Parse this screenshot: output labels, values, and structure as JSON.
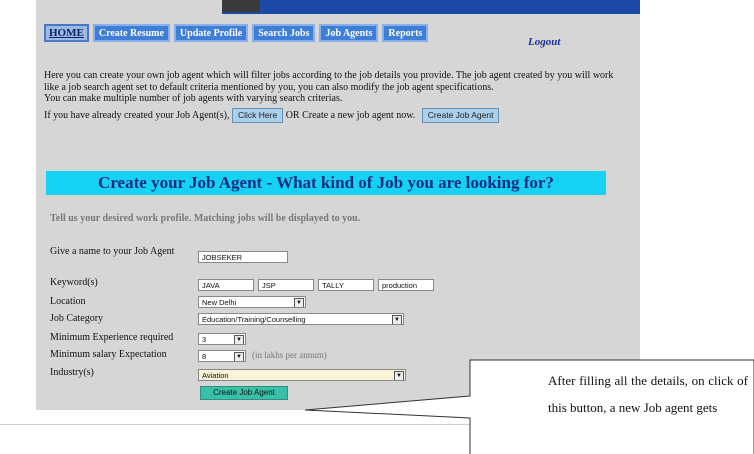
{
  "nav": {
    "home": "HOME",
    "items": [
      "Create Resume",
      "Update Profile",
      "Search Jobs",
      "Job Agents",
      "Reports"
    ],
    "logout": "Logout"
  },
  "intro": {
    "p1": "Here you can create your own job agent which will filter jobs according to the job details you provide. The job agent created by you will work like a job search agent set to default criteria mentioned by you, you can also modify the job agent specifications.",
    "p2": "You can make multiple number of job agents with varying search criterias.",
    "p3_before": "If you have already created your Job Agent(s),",
    "click_here": "Click Here",
    "p3_middle": "OR Create a new job agent now.",
    "create_job_agent_top": "Create Job Agent"
  },
  "banner": "Create your Job Agent - What kind of Job you are looking for?",
  "tell": "Tell us your desired work profile. Matching jobs will be displayed to you.",
  "form": {
    "name_label": "Give a name to your Job Agent",
    "name_value": "JOBSEKER",
    "keywords_label": "Keyword(s)",
    "keywords": [
      "JAVA",
      "JSP",
      "TALLY",
      "production"
    ],
    "location_label": "Location",
    "location_value": "New Delhi",
    "category_label": "Job Category",
    "category_value": "Education/Training/Counselling",
    "experience_label": "Minimum Experience required",
    "experience_value": "3",
    "salary_label": "Minimum salary Expectation",
    "salary_value": "8",
    "salary_note": "(in lakhs per annum)",
    "industry_label": "Industry(s)",
    "industry_value": "Aviation",
    "submit": "Create Job Agent"
  },
  "callout": {
    "text": "After filling all the details, on click of this button, a new Job agent gets"
  },
  "colors": {
    "panel": "#d6d6d6",
    "banner_bg": "#16d2f2",
    "banner_text": "#0b2a88",
    "nav_button": "#3f7ed8",
    "submit": "#39c0a8"
  }
}
